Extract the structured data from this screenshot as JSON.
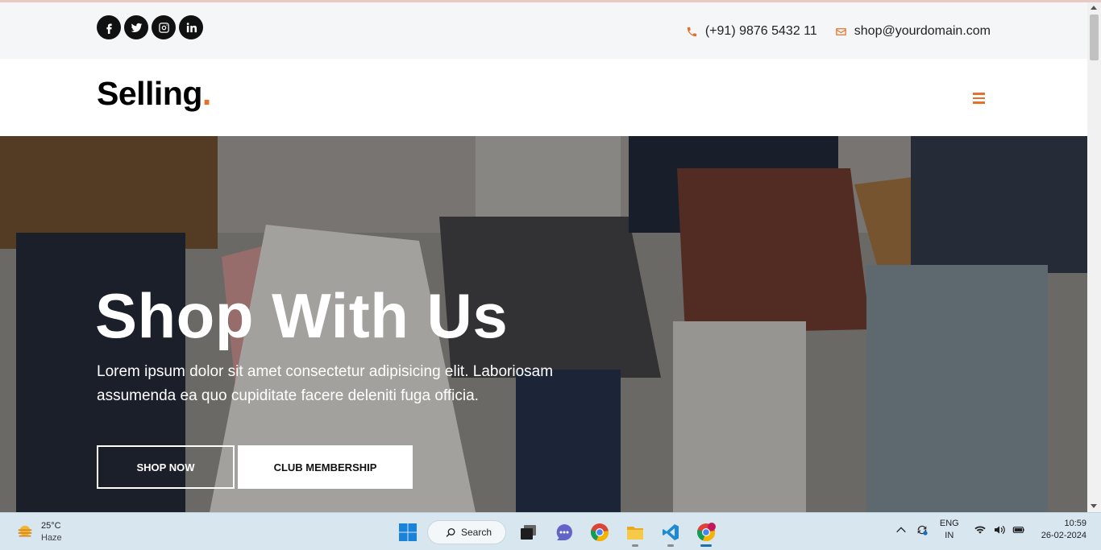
{
  "topbar": {
    "social": [
      "facebook-icon",
      "twitter-icon",
      "instagram-icon",
      "linkedin-icon"
    ],
    "phone": "(+91) 9876 5432 11",
    "email": "shop@yourdomain.com"
  },
  "header": {
    "logo_text": "Selling",
    "logo_dot": ".",
    "menu_icon": "hamburger-icon"
  },
  "hero": {
    "title": "Shop With Us",
    "description": "Lorem ipsum dolor sit amet consectetur adipisicing elit. Laboriosam assumenda ea quo cupiditate facere deleniti fuga officia.",
    "shop_button": "SHOP NOW",
    "club_button": "CLUB MEMBERSHIP"
  },
  "taskbar": {
    "weather": {
      "temp": "25°C",
      "condition": "Haze"
    },
    "search_label": "Search",
    "language": {
      "line1": "ENG",
      "line2": "IN"
    },
    "time": "10:59",
    "date": "26-02-2024"
  },
  "colors": {
    "accent": "#e4702a",
    "dark": "#111111",
    "taskbar": "#d7e6ef"
  }
}
